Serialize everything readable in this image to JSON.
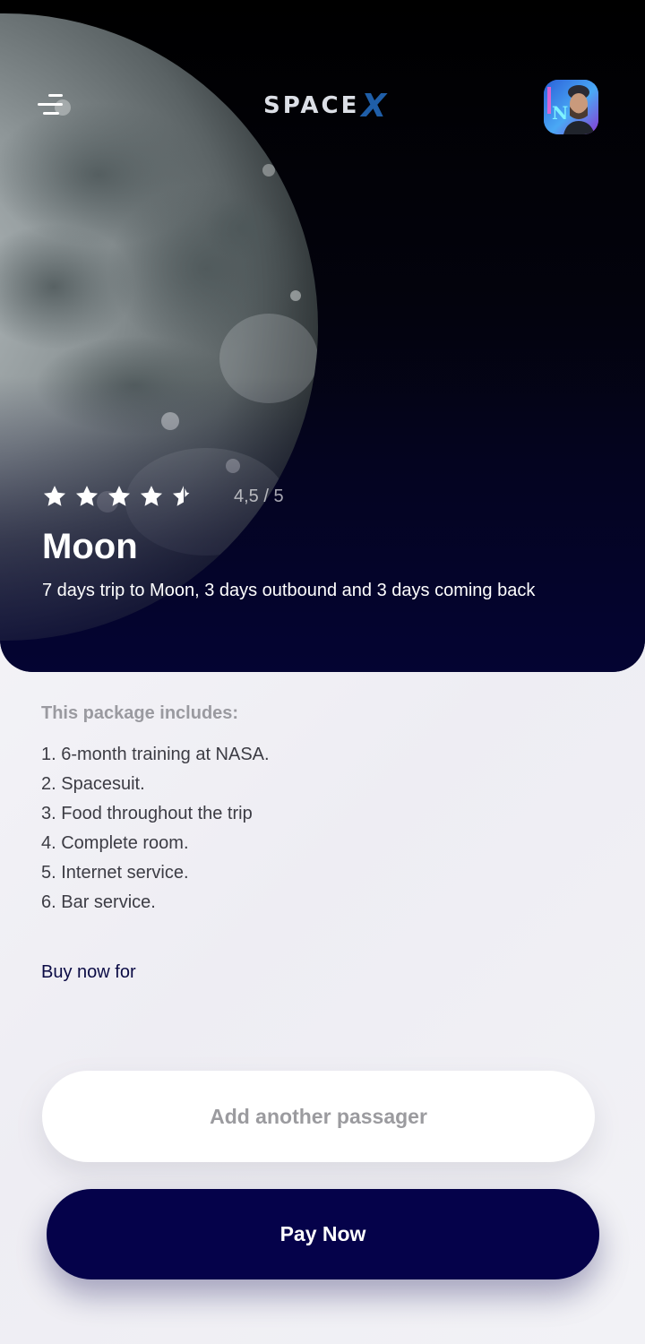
{
  "header": {
    "logo_text": "SPACE",
    "logo_x": "X",
    "menu_icon": "menu-icon",
    "avatar_icon": "user-avatar"
  },
  "destination": {
    "rating_value": 4.5,
    "rating_max": 5,
    "rating_text": "4,5 / 5",
    "name": "Moon",
    "description": "7 days trip to Moon, 3 days outbound and 3 days coming back"
  },
  "package": {
    "heading": "This package includes:",
    "items": [
      "1. 6-month training at NASA.",
      "2. Spacesuit.",
      "3. Food throughout the trip",
      "4. Complete room.",
      "5. Internet service.",
      "6. Bar service."
    ]
  },
  "purchase": {
    "buy_label": "Buy now for",
    "add_passenger_label": "Add another passager",
    "pay_label": "Pay Now"
  },
  "colors": {
    "primary": "#05024a",
    "logo_x": "#1f5ea8",
    "heading_gray": "#9a9aa0"
  }
}
